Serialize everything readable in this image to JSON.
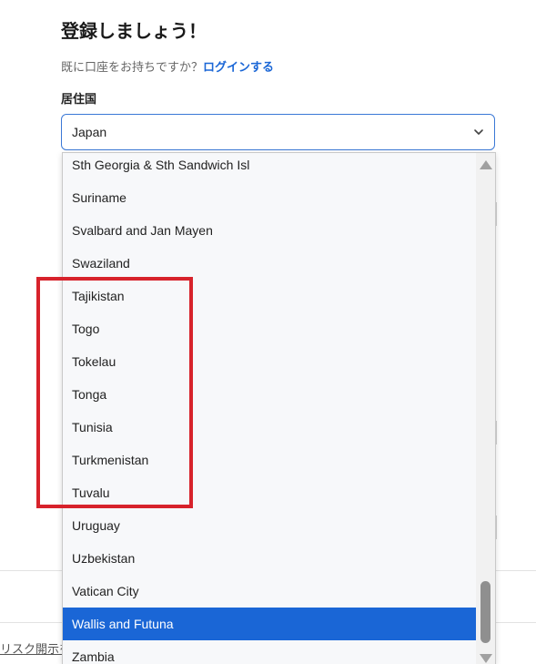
{
  "header": {
    "title": "登録しましょう！",
    "login_prompt": "既に口座をお持ちですか？",
    "login_link": "ログインする"
  },
  "country_field": {
    "label": "居住国",
    "selected_value": "Japan"
  },
  "dropdown": {
    "options": [
      "Sth Georgia & Sth Sandwich Isl",
      "Suriname",
      "Svalbard and Jan Mayen",
      "Swaziland",
      "Tajikistan",
      "Togo",
      "Tokelau",
      "Tonga",
      "Tunisia",
      "Turkmenistan",
      "Tuvalu",
      "Uruguay",
      "Uzbekistan",
      "Vatican City",
      "Wallis and Futuna",
      "Zambia"
    ],
    "highlighted_option": "Wallis and Futuna"
  },
  "footer": {
    "partial_text": "リスク開示を"
  },
  "colors": {
    "accent": "#1a66d6",
    "annotation_box": "#d7222b"
  }
}
